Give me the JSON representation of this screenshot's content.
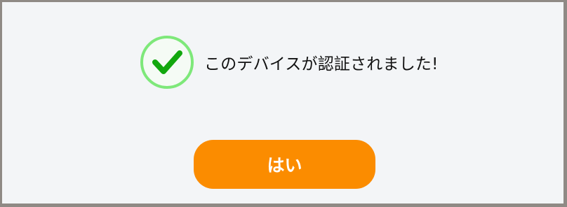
{
  "dialog": {
    "message": "このデバイスが認証されました!",
    "status_icon": "check-circle-icon",
    "yes_label": "はい"
  },
  "colors": {
    "dialog_background": "#f3f5f7",
    "frame": "#8f8a85",
    "check_ring": "#7ee87a",
    "check_mark": "#12a70e",
    "button_background": "#fb8c00",
    "button_text": "#ffffff",
    "text": "#111111"
  }
}
